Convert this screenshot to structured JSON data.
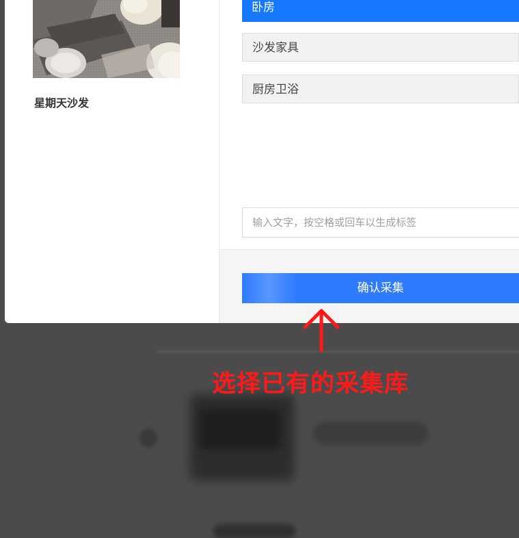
{
  "preview": {
    "item_name": "星期天沙发"
  },
  "libraries": [
    {
      "label": "卧房",
      "selected": true
    },
    {
      "label": "沙发家具",
      "selected": false
    },
    {
      "label": "厨房卫浴",
      "selected": false
    }
  ],
  "tag_input": {
    "placeholder": "输入文字，按空格或回车以生成标签",
    "value": ""
  },
  "confirm_button": {
    "label": "确认采集"
  },
  "annotation": {
    "text": "选择已有的采集库",
    "color": "#ff1a1a"
  },
  "colors": {
    "accent": "#1677ff",
    "button": "#2f7bff",
    "overlay": "#4b4b4b"
  }
}
